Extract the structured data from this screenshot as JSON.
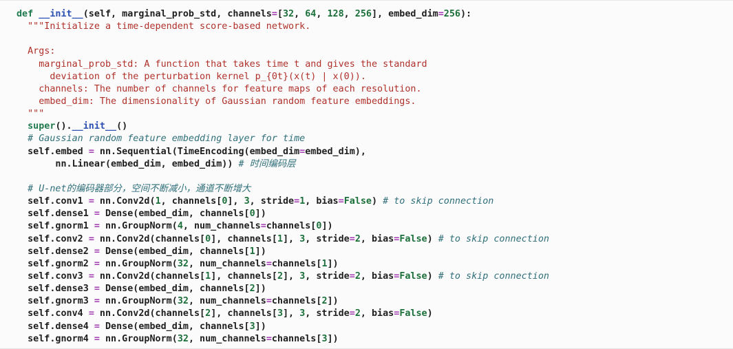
{
  "lines": [
    [
      {
        "c": "kw",
        "t": "def"
      },
      {
        "c": "",
        "t": " "
      },
      {
        "c": "fn",
        "t": "__init__"
      },
      {
        "c": "",
        "t": "(self, marginal_prob_std, channels"
      },
      {
        "c": "op",
        "t": "="
      },
      {
        "c": "",
        "t": "["
      },
      {
        "c": "num",
        "t": "32"
      },
      {
        "c": "",
        "t": ", "
      },
      {
        "c": "num",
        "t": "64"
      },
      {
        "c": "",
        "t": ", "
      },
      {
        "c": "num",
        "t": "128"
      },
      {
        "c": "",
        "t": ", "
      },
      {
        "c": "num",
        "t": "256"
      },
      {
        "c": "",
        "t": "], embed_dim"
      },
      {
        "c": "op",
        "t": "="
      },
      {
        "c": "num",
        "t": "256"
      },
      {
        "c": "",
        "t": "):"
      }
    ],
    [
      {
        "c": "str",
        "t": "  \"\"\"Initialize a time-dependent score-based network."
      }
    ],
    [
      {
        "c": "",
        "t": ""
      }
    ],
    [
      {
        "c": "str",
        "t": "  Args:"
      }
    ],
    [
      {
        "c": "str",
        "t": "    marginal_prob_std: A function that takes time t and gives the standard"
      }
    ],
    [
      {
        "c": "str",
        "t": "      deviation of the perturbation kernel p_{0t}(x(t) | x(0))."
      }
    ],
    [
      {
        "c": "str",
        "t": "    channels: The number of channels for feature maps of each resolution."
      }
    ],
    [
      {
        "c": "str",
        "t": "    embed_dim: The dimensionality of Gaussian random feature embeddings."
      }
    ],
    [
      {
        "c": "str",
        "t": "  \"\"\""
      }
    ],
    [
      {
        "c": "",
        "t": "  "
      },
      {
        "c": "kw",
        "t": "super"
      },
      {
        "c": "",
        "t": "()."
      },
      {
        "c": "fn",
        "t": "__init__"
      },
      {
        "c": "",
        "t": "()"
      }
    ],
    [
      {
        "c": "cm",
        "t": "  # Gaussian random feature embedding layer for time"
      }
    ],
    [
      {
        "c": "",
        "t": "  self.embed "
      },
      {
        "c": "op",
        "t": "="
      },
      {
        "c": "",
        "t": " nn.Sequential(TimeEncoding(embed_dim"
      },
      {
        "c": "op",
        "t": "="
      },
      {
        "c": "",
        "t": "embed_dim),"
      }
    ],
    [
      {
        "c": "",
        "t": "       nn.Linear(embed_dim, embed_dim)) "
      },
      {
        "c": "cm",
        "t": "# 时间编码层"
      }
    ],
    [
      {
        "c": "",
        "t": ""
      }
    ],
    [
      {
        "c": "cm",
        "t": "  # U-net的编码器部分，空间不断减小，通道不断增大"
      }
    ],
    [
      {
        "c": "",
        "t": "  self.conv1 "
      },
      {
        "c": "op",
        "t": "="
      },
      {
        "c": "",
        "t": " nn.Conv2d("
      },
      {
        "c": "num",
        "t": "1"
      },
      {
        "c": "",
        "t": ", channels["
      },
      {
        "c": "num",
        "t": "0"
      },
      {
        "c": "",
        "t": "], "
      },
      {
        "c": "num",
        "t": "3"
      },
      {
        "c": "",
        "t": ", stride"
      },
      {
        "c": "op",
        "t": "="
      },
      {
        "c": "num",
        "t": "1"
      },
      {
        "c": "",
        "t": ", bias"
      },
      {
        "c": "op",
        "t": "="
      },
      {
        "c": "kwval",
        "t": "False"
      },
      {
        "c": "",
        "t": ") "
      },
      {
        "c": "cm",
        "t": "# to skip connection"
      }
    ],
    [
      {
        "c": "",
        "t": "  self.dense1 "
      },
      {
        "c": "op",
        "t": "="
      },
      {
        "c": "",
        "t": " Dense(embed_dim, channels["
      },
      {
        "c": "num",
        "t": "0"
      },
      {
        "c": "",
        "t": "])"
      }
    ],
    [
      {
        "c": "",
        "t": "  self.gnorm1 "
      },
      {
        "c": "op",
        "t": "="
      },
      {
        "c": "",
        "t": " nn.GroupNorm("
      },
      {
        "c": "num",
        "t": "4"
      },
      {
        "c": "",
        "t": ", num_channels"
      },
      {
        "c": "op",
        "t": "="
      },
      {
        "c": "",
        "t": "channels["
      },
      {
        "c": "num",
        "t": "0"
      },
      {
        "c": "",
        "t": "])"
      }
    ],
    [
      {
        "c": "",
        "t": "  self.conv2 "
      },
      {
        "c": "op",
        "t": "="
      },
      {
        "c": "",
        "t": " nn.Conv2d(channels["
      },
      {
        "c": "num",
        "t": "0"
      },
      {
        "c": "",
        "t": "], channels["
      },
      {
        "c": "num",
        "t": "1"
      },
      {
        "c": "",
        "t": "], "
      },
      {
        "c": "num",
        "t": "3"
      },
      {
        "c": "",
        "t": ", stride"
      },
      {
        "c": "op",
        "t": "="
      },
      {
        "c": "num",
        "t": "2"
      },
      {
        "c": "",
        "t": ", bias"
      },
      {
        "c": "op",
        "t": "="
      },
      {
        "c": "kwval",
        "t": "False"
      },
      {
        "c": "",
        "t": ") "
      },
      {
        "c": "cm",
        "t": "# to skip connection"
      }
    ],
    [
      {
        "c": "",
        "t": "  self.dense2 "
      },
      {
        "c": "op",
        "t": "="
      },
      {
        "c": "",
        "t": " Dense(embed_dim, channels["
      },
      {
        "c": "num",
        "t": "1"
      },
      {
        "c": "",
        "t": "])"
      }
    ],
    [
      {
        "c": "",
        "t": "  self.gnorm2 "
      },
      {
        "c": "op",
        "t": "="
      },
      {
        "c": "",
        "t": " nn.GroupNorm("
      },
      {
        "c": "num",
        "t": "32"
      },
      {
        "c": "",
        "t": ", num_channels"
      },
      {
        "c": "op",
        "t": "="
      },
      {
        "c": "",
        "t": "channels["
      },
      {
        "c": "num",
        "t": "1"
      },
      {
        "c": "",
        "t": "])"
      }
    ],
    [
      {
        "c": "",
        "t": "  self.conv3 "
      },
      {
        "c": "op",
        "t": "="
      },
      {
        "c": "",
        "t": " nn.Conv2d(channels["
      },
      {
        "c": "num",
        "t": "1"
      },
      {
        "c": "",
        "t": "], channels["
      },
      {
        "c": "num",
        "t": "2"
      },
      {
        "c": "",
        "t": "], "
      },
      {
        "c": "num",
        "t": "3"
      },
      {
        "c": "",
        "t": ", stride"
      },
      {
        "c": "op",
        "t": "="
      },
      {
        "c": "num",
        "t": "2"
      },
      {
        "c": "",
        "t": ", bias"
      },
      {
        "c": "op",
        "t": "="
      },
      {
        "c": "kwval",
        "t": "False"
      },
      {
        "c": "",
        "t": ") "
      },
      {
        "c": "cm",
        "t": "# to skip connection"
      }
    ],
    [
      {
        "c": "",
        "t": "  self.dense3 "
      },
      {
        "c": "op",
        "t": "="
      },
      {
        "c": "",
        "t": " Dense(embed_dim, channels["
      },
      {
        "c": "num",
        "t": "2"
      },
      {
        "c": "",
        "t": "])"
      }
    ],
    [
      {
        "c": "",
        "t": "  self.gnorm3 "
      },
      {
        "c": "op",
        "t": "="
      },
      {
        "c": "",
        "t": " nn.GroupNorm("
      },
      {
        "c": "num",
        "t": "32"
      },
      {
        "c": "",
        "t": ", num_channels"
      },
      {
        "c": "op",
        "t": "="
      },
      {
        "c": "",
        "t": "channels["
      },
      {
        "c": "num",
        "t": "2"
      },
      {
        "c": "",
        "t": "])"
      }
    ],
    [
      {
        "c": "",
        "t": "  self.conv4 "
      },
      {
        "c": "op",
        "t": "="
      },
      {
        "c": "",
        "t": " nn.Conv2d(channels["
      },
      {
        "c": "num",
        "t": "2"
      },
      {
        "c": "",
        "t": "], channels["
      },
      {
        "c": "num",
        "t": "3"
      },
      {
        "c": "",
        "t": "], "
      },
      {
        "c": "num",
        "t": "3"
      },
      {
        "c": "",
        "t": ", stride"
      },
      {
        "c": "op",
        "t": "="
      },
      {
        "c": "num",
        "t": "2"
      },
      {
        "c": "",
        "t": ", bias"
      },
      {
        "c": "op",
        "t": "="
      },
      {
        "c": "kwval",
        "t": "False"
      },
      {
        "c": "",
        "t": ")"
      }
    ],
    [
      {
        "c": "",
        "t": "  self.dense4 "
      },
      {
        "c": "op",
        "t": "="
      },
      {
        "c": "",
        "t": " Dense(embed_dim, channels["
      },
      {
        "c": "num",
        "t": "3"
      },
      {
        "c": "",
        "t": "])"
      }
    ],
    [
      {
        "c": "",
        "t": "  self.gnorm4 "
      },
      {
        "c": "op",
        "t": "="
      },
      {
        "c": "",
        "t": " nn.GroupNorm("
      },
      {
        "c": "num",
        "t": "32"
      },
      {
        "c": "",
        "t": ", num_channels"
      },
      {
        "c": "op",
        "t": "="
      },
      {
        "c": "",
        "t": "channels["
      },
      {
        "c": "num",
        "t": "3"
      },
      {
        "c": "",
        "t": "])"
      }
    ]
  ]
}
